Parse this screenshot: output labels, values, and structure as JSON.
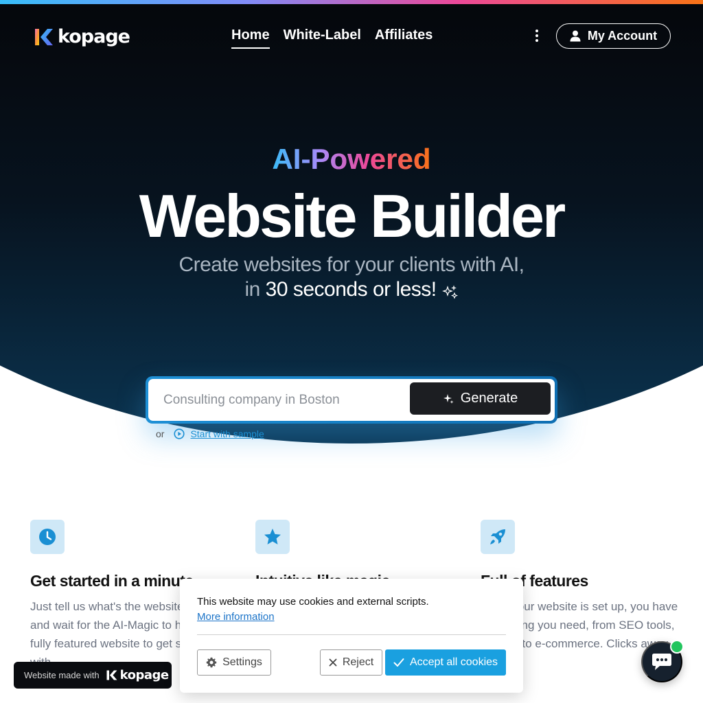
{
  "brand": {
    "name": "kopage"
  },
  "nav": {
    "links": [
      "Home",
      "White-Label",
      "Affiliates"
    ],
    "active": "Home",
    "account_label": "My Account"
  },
  "hero": {
    "eyebrow": "AI-Powered",
    "headline": "Website Builder",
    "subline_1": "Create websites for your clients with AI,",
    "subline_2_dim": "in ",
    "subline_2_bright": "30 seconds or less!",
    "sparkle": "✨"
  },
  "search": {
    "placeholder": "Consulting company in Boston",
    "generate_label": "Generate",
    "or_label": "or",
    "sample_label": "Start with sample"
  },
  "features": [
    {
      "icon": "clock-icon",
      "title": "Get started in a minute",
      "text": "Just tell us what's the website about and wait for the AI-Magic to happen! A fully featured website to get started with."
    },
    {
      "icon": "star-icon",
      "title": "Intuitive like magic",
      "text": ""
    },
    {
      "icon": "rocket-icon",
      "title": "Full of features",
      "text": "Once your website is set up, you have everything you need, from SEO tools, to blog, to e-commerce. Clicks away."
    }
  ],
  "badge": {
    "label": "Website made with",
    "brand": "kopage"
  },
  "cookie": {
    "text": "This website may use cookies and external scripts.",
    "more_info": "More information",
    "settings_label": "Settings",
    "reject_label": "Reject",
    "accept_label": "Accept all cookies"
  },
  "colors": {
    "accent": "#1aa0e0",
    "hero_top": "#05070b",
    "hero_bottom": "#0b3552",
    "chat_online": "#22c55e"
  }
}
